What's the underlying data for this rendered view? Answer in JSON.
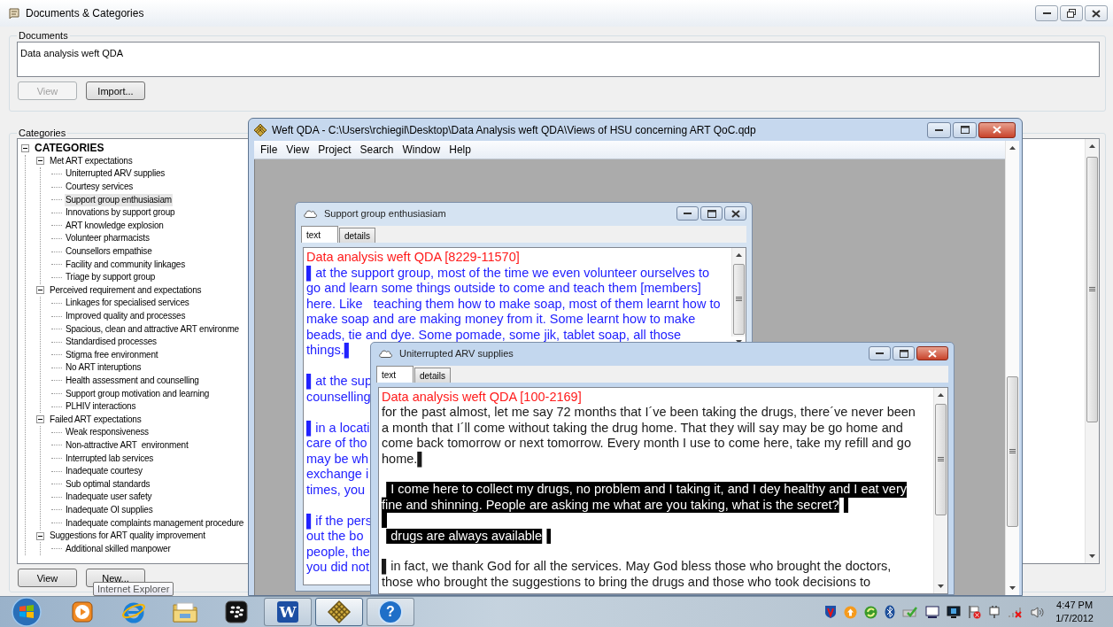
{
  "main_window": {
    "title": "Documents & Categories",
    "documents": {
      "label": "Documents",
      "items": [
        "Data analysis weft QDA"
      ],
      "buttons": [
        {
          "label": "View",
          "disabled": true
        },
        {
          "label": "Import...",
          "disabled": false
        }
      ]
    },
    "categories": {
      "label": "Categories",
      "tree": [
        {
          "text": "CATEGORIES",
          "expanded": true,
          "selected": false,
          "children": [
            {
              "text": "Met ART expectations",
              "expanded": true,
              "selected": false,
              "children": [
                {
                  "text": "Uniterrupted ARV supplies",
                  "selected": false
                },
                {
                  "text": "Courtesy services",
                  "selected": false
                },
                {
                  "text": "Support group enthusiasiam",
                  "selected": true
                },
                {
                  "text": "Innovations by support group",
                  "selected": false
                },
                {
                  "text": "ART knowledge explosion",
                  "selected": false
                },
                {
                  "text": "Volunteer pharmacists",
                  "selected": false
                },
                {
                  "text": "Counsellors empathise",
                  "selected": false
                },
                {
                  "text": "Facility and community linkages",
                  "selected": false
                },
                {
                  "text": "Triage by support group",
                  "selected": false
                }
              ]
            },
            {
              "text": "Perceived requirement and expectations",
              "expanded": true,
              "selected": false,
              "children": [
                {
                  "text": "Linkages for specialised services",
                  "selected": false
                },
                {
                  "text": "Improved quality and processes",
                  "selected": false
                },
                {
                  "text": "Spacious, clean and attractive ART environme",
                  "selected": false
                },
                {
                  "text": "Standardised processes",
                  "selected": false
                },
                {
                  "text": "Stigma free environment",
                  "selected": false
                },
                {
                  "text": "No ART interuptions",
                  "selected": false
                },
                {
                  "text": "Health assessment and counselling",
                  "selected": false
                },
                {
                  "text": "Support group motivation and learning",
                  "selected": false
                },
                {
                  "text": "PLHIV interactions",
                  "selected": false
                }
              ]
            },
            {
              "text": "Failed ART expectations",
              "expanded": true,
              "selected": false,
              "children": [
                {
                  "text": "Weak responsiveness",
                  "selected": false
                },
                {
                  "text": "Non-attractive ART  environment",
                  "selected": false
                },
                {
                  "text": "Interrupted lab services",
                  "selected": false
                },
                {
                  "text": "Inadequate courtesy",
                  "selected": false
                },
                {
                  "text": "Sub optimal standards",
                  "selected": false
                },
                {
                  "text": "Inadequate user safety",
                  "selected": false
                },
                {
                  "text": "Inadequate OI supplies",
                  "selected": false
                },
                {
                  "text": "Inadequate complaints management procedure",
                  "selected": false
                }
              ]
            },
            {
              "text": "Suggestions for ART quality improvement",
              "expanded": true,
              "selected": false,
              "children": [
                {
                  "text": "Additional skilled manpower",
                  "selected": false
                }
              ]
            }
          ]
        }
      ],
      "buttons": [
        {
          "label": "View",
          "disabled": false
        },
        {
          "label": "New...",
          "disabled": false
        }
      ]
    },
    "tooltip": "Internet Explorer"
  },
  "weft_window": {
    "title": "Weft QDA - C:\\Users\\rchiegil\\Desktop\\Data Analysis weft QDA\\Views of HSU concerning ART QoC.qdp",
    "menu": [
      "File",
      "View",
      "Project",
      "Search",
      "Window",
      "Help"
    ],
    "documents": [
      {
        "title": "Support group enthusiasiam",
        "active": false,
        "tabs": [
          {
            "label": "text",
            "selected": true
          },
          {
            "label": "details",
            "selected": false
          }
        ],
        "lines": [
          {
            "kind": "header",
            "text": "Data analysis weft QDA [8229-11570]",
            "selected": false
          },
          {
            "kind": "coded",
            "text": "▌at the support group, most of the time we even volunteer ourselves to",
            "selected": false
          },
          {
            "kind": "coded",
            "text": "go and learn some things outside to come and teach them [members]",
            "selected": false
          },
          {
            "kind": "coded",
            "text": "here. Like   teaching them how to make soap, most of them learnt how to",
            "selected": false
          },
          {
            "kind": "coded",
            "text": "make soap and are making money from it. Some learnt how to make",
            "selected": false
          },
          {
            "kind": "coded",
            "text": "beads, tie and dye. Some pomade, some jik, tablet soap, all those",
            "selected": false
          },
          {
            "kind": "coded",
            "text": "things.▌",
            "selected": false
          },
          {
            "kind": "blank",
            "selected": false
          },
          {
            "kind": "coded",
            "text": "▌at the sup",
            "selected": false
          },
          {
            "kind": "coded",
            "text": "counselling",
            "selected": false
          },
          {
            "kind": "blank",
            "selected": false
          },
          {
            "kind": "coded",
            "text": "▌in a locati",
            "selected": false
          },
          {
            "kind": "coded",
            "text": "care of tho",
            "selected": false
          },
          {
            "kind": "coded",
            "text": "may be wh",
            "selected": false
          },
          {
            "kind": "coded",
            "text": "exchange i",
            "selected": false
          },
          {
            "kind": "coded",
            "text": "times, you",
            "selected": false
          },
          {
            "kind": "blank",
            "selected": false
          },
          {
            "kind": "coded",
            "text": "▌if the pers",
            "selected": false
          },
          {
            "kind": "coded",
            "text": "out the bo",
            "selected": false
          },
          {
            "kind": "coded",
            "text": "people, the",
            "selected": false
          },
          {
            "kind": "coded",
            "text": "you did not",
            "selected": false
          }
        ]
      },
      {
        "title": "Uniterrupted ARV supplies",
        "active": true,
        "tabs": [
          {
            "label": "text",
            "selected": true
          },
          {
            "label": "details",
            "selected": false
          }
        ],
        "lines": [
          {
            "kind": "header",
            "text": "Data analysis weft QDA [100-2169]",
            "selected": false
          },
          {
            "kind": "body",
            "text": "for the past almost, let me say 72 months that I´ve been taking the drugs, there´ve never been",
            "selected": false
          },
          {
            "kind": "body",
            "text": "a month that I´ll come without taking the drug home. That they will say may be go home and",
            "selected": false
          },
          {
            "kind": "body",
            "text": "come back tomorrow or next tomorrow. Every month I use to come here, take my refill and go",
            "selected": false
          },
          {
            "kind": "body",
            "text": "home.▌",
            "selected": false
          },
          {
            "kind": "blank",
            "selected": false
          },
          {
            "kind": "body",
            "text": "▌I come here to collect my drugs, no problem and I taking it, and I dey healthy and I eat very",
            "selected": true
          },
          {
            "kind": "body",
            "text": "fine and shinning. People are asking me what are you taking, what is the secret?▌",
            "selected": true
          },
          {
            "kind": "blank",
            "selected": true
          },
          {
            "kind": "body",
            "text": "▌drugs are always available▌",
            "selected": true
          },
          {
            "kind": "blank",
            "selected": false
          },
          {
            "kind": "body",
            "text": "▌in fact, we thank God for all the services. May God bless those who brought the doctors,",
            "selected": false
          },
          {
            "kind": "body",
            "text": "those who brought the suggestions to bring the drugs and those who took decisions to",
            "selected": false
          }
        ]
      }
    ]
  },
  "taskbar": {
    "apps": [
      {
        "kind": "media",
        "running": false,
        "selected": false
      },
      {
        "kind": "browser",
        "running": false,
        "selected": false
      },
      {
        "kind": "folder",
        "running": false,
        "selected": false
      },
      {
        "kind": "dots",
        "running": false,
        "selected": false
      },
      {
        "kind": "word",
        "label": "W",
        "running": true,
        "selected": false
      },
      {
        "kind": "weft",
        "running": true,
        "selected": true
      },
      {
        "kind": "help",
        "label": "?",
        "running": true,
        "selected": false
      }
    ],
    "time": "4:47 PM",
    "date": "1/7/2012"
  }
}
